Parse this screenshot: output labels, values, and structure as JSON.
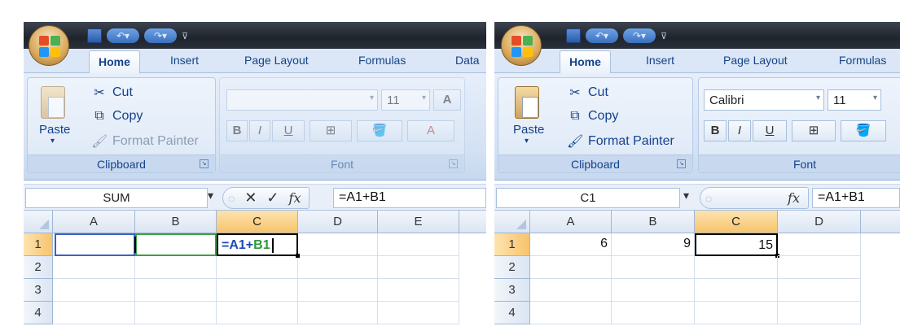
{
  "colors": {
    "accent": "#15428b",
    "ribbon": "#dbe7f6",
    "selected_header": "#f7c46c",
    "ref_a1": "#1f49b8",
    "ref_b1": "#2f9a3a"
  },
  "left": {
    "tabs": [
      "Home",
      "Insert",
      "Page Layout",
      "Formulas",
      "Data"
    ],
    "clipboard": {
      "paste": "Paste",
      "cut": "Cut",
      "copy": "Copy",
      "format_painter": "Format Painter",
      "label": "Clipboard"
    },
    "font": {
      "name": "",
      "size": "11",
      "label": "Font",
      "bold": "B",
      "italic": "I",
      "underline": "U",
      "grow": "A",
      "shrink": "A"
    },
    "name_box": "SUM",
    "formula": "=A1+B1",
    "columns": [
      "A",
      "B",
      "C",
      "D",
      "E"
    ],
    "rows": [
      "1",
      "2",
      "3",
      "4"
    ],
    "edit_cell": {
      "ref_a": "=A1",
      "op": "+",
      "ref_b": "B1"
    }
  },
  "right": {
    "tabs": [
      "Home",
      "Insert",
      "Page Layout",
      "Formulas"
    ],
    "clipboard": {
      "paste": "Paste",
      "cut": "Cut",
      "copy": "Copy",
      "format_painter": "Format Painter",
      "label": "Clipboard"
    },
    "font": {
      "name": "Calibri",
      "size": "11",
      "label": "Font",
      "bold": "B",
      "italic": "I",
      "underline": "U"
    },
    "name_box": "C1",
    "formula": "=A1+B1",
    "columns": [
      "A",
      "B",
      "C",
      "D"
    ],
    "rows": [
      "1",
      "2",
      "3",
      "4"
    ],
    "values": {
      "a1": "6",
      "b1": "9",
      "c1": "15"
    }
  },
  "icons": {
    "office": "office-button-icon",
    "save": "save-icon",
    "undo": "undo-icon",
    "redo": "redo-icon",
    "cut": "scissors-icon",
    "copy": "copy-icon",
    "format_painter": "brush-icon",
    "fx": "function-icon"
  },
  "glyphs": {
    "cut": "✂",
    "copy": "⧉",
    "brush": "🖌",
    "cancel": "✕",
    "enter": "✓",
    "fx": "fx",
    "dd": "▾",
    "launcher": "↘"
  }
}
